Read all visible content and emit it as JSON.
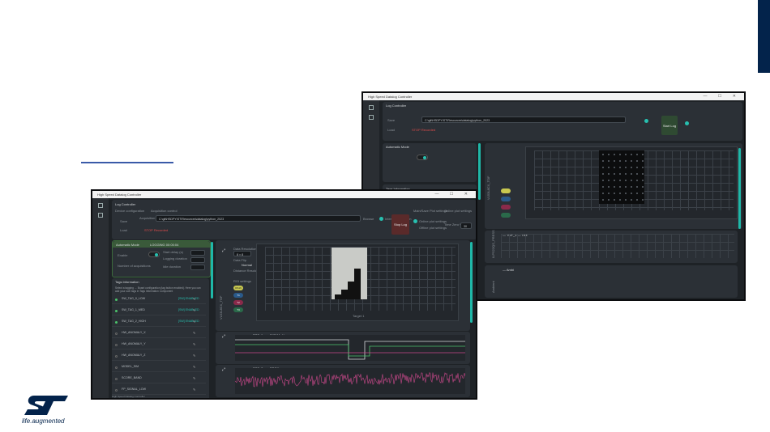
{
  "app": {
    "title": "High Speed Datalog Controller",
    "controls": "— ☐ ✕"
  },
  "front": {
    "log_controller_title": "Log Controller",
    "device_config_label": "Device configuration",
    "acquisition_control_label": "Acquisition control",
    "save_label": "Save",
    "load_label": "Load",
    "acq_folder_label": "Acquisition Folder",
    "acq_folder_value": "C:\\git\\HSDPY\\ST\\Resources\\datalog\\python_2023",
    "browse_label": "Browse",
    "interface_label": "Interface selection",
    "stop_label": "Stop Log",
    "stop_status": "STOP Recorded",
    "plot_settings_label": "Main/Save Plot settings",
    "online_settings_label": "Online plot settings",
    "online_plot_label": "Online plot settings",
    "offline_plot_label": "Offline plot settings",
    "time_window_label": "Time Zero Window",
    "time_window_value": "30",
    "auto_mode_title": "Automatic Mode",
    "auto_mode_timer": "LOGGING 00:00:04",
    "enable_label": "Enable",
    "start_delay_label": "Start delay (s)",
    "logging_duration_label": "Logging duration",
    "number_acq_label": "Number of acquisitions",
    "idle_duration_label": "Idle duration",
    "tags_title": "Tags Information",
    "tags_note": "Select a tagging → Board configuration (tag button enabled). Here you can add your own tags in Tags Information Component",
    "tags": [
      {
        "name": "SW_TAG_0_LOW",
        "status": "[SW] ENABLED",
        "on": true
      },
      {
        "name": "SW_TAG_1_MED",
        "status": "[SW] ENABLED",
        "on": true
      },
      {
        "name": "SW_TAG_2_HIGH",
        "status": "[SW] ENABLED",
        "on": true
      },
      {
        "name": "HW_ANOMALY_X",
        "status": "",
        "on": false
      },
      {
        "name": "HW_ANOMALY_Y",
        "status": "",
        "on": false
      },
      {
        "name": "HW_ANOMALY_Z",
        "status": "",
        "on": false
      },
      {
        "name": "MODEL_SIM",
        "status": "",
        "on": false
      },
      {
        "name": "SCORE_BAND",
        "status": "",
        "on": false
      },
      {
        "name": "FP_SIGNAL_LOW",
        "status": "",
        "on": false
      }
    ],
    "tof_title": "VL53L8CX_TOF",
    "data_format_label": "Data Resolution",
    "data_format_value": "8 × 8",
    "data_flip_label": "Data Flip",
    "data_flip_value": "Normal",
    "distance_label": "Distance Resolution",
    "roi_label": "ROI settings",
    "chip_labels": [
      "RS16",
      "T1",
      "T2",
      "T3"
    ],
    "plot1_legend": "TOF_1 — ~SIGMA_X",
    "plot2_legend": "TOF_2 — ~PROX",
    "xaxis_label": "Target 1",
    "footer": "High Speed Datalog Controller"
  },
  "back": {
    "log_controller_title": "Log Controller",
    "save_label": "Save",
    "load_label": "Load",
    "acq_folder_value": "C:\\git\\HSDPY\\ST\\Resources\\datalog\\python_2023",
    "stop_status": "STOP Recorded",
    "start_label": "Start Log",
    "auto_mode_title": "Automatic Mode",
    "tags_title": "Tags Information",
    "plot_side1": "VL53L8CX_TOF",
    "plot_side2": "ILPS22QS_PRESS",
    "plot_side3": "Ambient",
    "legend_a": "— TOF_1 — TIM",
    "legend_b": "— Ambi"
  },
  "brand": {
    "tagline": "life.augmented",
    "color": "#03234b"
  },
  "colors": {
    "accent": "#27c0b0",
    "stop": "#5a2a2a",
    "start": "#2f4a32",
    "series_green": "#4cc46b",
    "series_pink": "#c8488a",
    "series_white": "#d6d9dc"
  }
}
